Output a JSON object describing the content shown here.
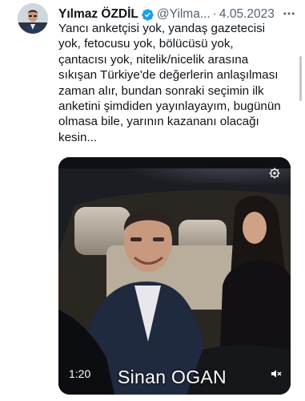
{
  "tweet": {
    "author_name": "Yılmaz ÖZDİL",
    "handle": "@Yilma...",
    "separator": "·",
    "date": "4.05.2023",
    "lines": [
      "Yancı anketçisi yok, yandaş gazetecisi",
      "yok, fetocusu yok, bölücüsü yok,",
      "çantacısı yok, nitelik/nicelik arasına",
      "sıkışan Türkiye'de değerlerin anlaşılması",
      "zaman alır, bundan sonraki seçimin ilk",
      "anketini şimdiden yayınlayayım, bugünün",
      "olmasa bile, yarının kazananı olacağı",
      "kesin..."
    ]
  },
  "video": {
    "time": "1:20",
    "caption": "Sinan OGAN"
  },
  "colors": {
    "verified": "#1d9bf0",
    "muted_text": "#536471",
    "text": "#0f1419"
  },
  "icons": {
    "verified": "verified-badge-icon",
    "more": "more-icon",
    "settings": "settings-icon",
    "mute": "volume-muted-icon"
  }
}
